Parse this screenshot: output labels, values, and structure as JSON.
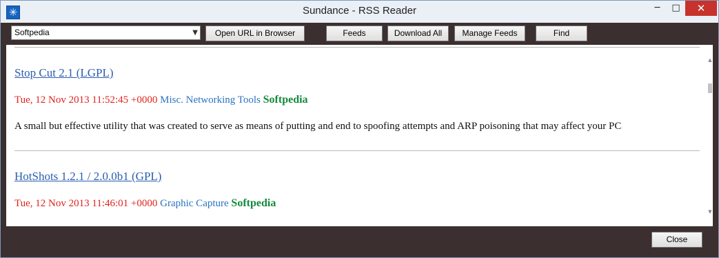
{
  "window": {
    "title": "Sundance - RSS Reader",
    "icon": "sundance-snowflake-icon",
    "close_color": "#c7322c"
  },
  "toolbar": {
    "feed_select": {
      "selected": "Softpedia"
    },
    "buttons": {
      "open_url": "Open URL in Browser",
      "feeds": "Feeds",
      "download_all": "Download All",
      "manage_feeds": "Manage Feeds",
      "find": "Find"
    }
  },
  "items": [
    {
      "title": "Stop Cut 2.1 (LGPL)",
      "date": "Tue, 12 Nov 2013 11:52:45 +0000",
      "category": "Misc. Networking Tools",
      "source": "Softpedia",
      "description": "A small but effective utility that was created to serve as means of putting and end to spoofing attempts and ARP poisoning that may affect your PC"
    },
    {
      "title": "HotShots 1.2.1 / 2.0.0b1 (GPL)",
      "date": "Tue, 12 Nov 2013 11:46:01 +0000",
      "category": "Graphic Capture",
      "source": "Softpedia"
    }
  ],
  "colors": {
    "date": "#e0221b",
    "category": "#2a73c0",
    "source": "#128a3b",
    "link": "#2a5db0"
  },
  "footer": {
    "close_label": "Close"
  }
}
